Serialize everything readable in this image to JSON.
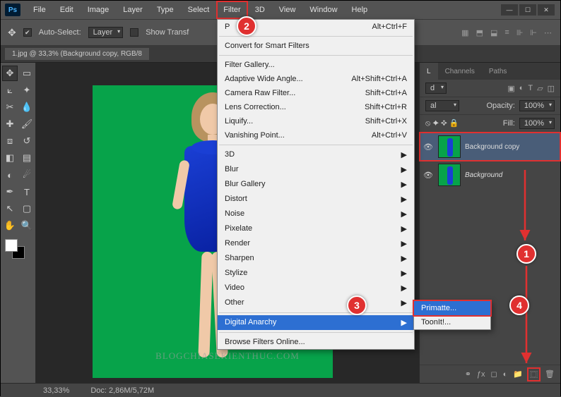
{
  "menubar": [
    "File",
    "Edit",
    "Image",
    "Layer",
    "Type",
    "Select",
    "Filter",
    "3D",
    "View",
    "Window",
    "Help"
  ],
  "active_menu_index": 6,
  "optbar": {
    "auto_select": "Auto-Select:",
    "layer_sel": "Layer",
    "show_transform": "Show Transf"
  },
  "doc_tab": "1.jpg @ 33,3% (Background copy, RGB/8",
  "filter_menu": {
    "top": {
      "label": "P",
      "shortcut": "Alt+Ctrl+F"
    },
    "convert": "Convert for Smart Filters",
    "gallery": "Filter Gallery...",
    "adaptive": {
      "label": "Adaptive Wide Angle...",
      "shortcut": "Alt+Shift+Ctrl+A"
    },
    "raw": {
      "label": "Camera Raw Filter...",
      "shortcut": "Shift+Ctrl+A"
    },
    "lens": {
      "label": "Lens Correction...",
      "shortcut": "Shift+Ctrl+R"
    },
    "liquify": {
      "label": "Liquify...",
      "shortcut": "Shift+Ctrl+X"
    },
    "vanish": {
      "label": "Vanishing Point...",
      "shortcut": "Alt+Ctrl+V"
    },
    "subs": [
      "3D",
      "Blur",
      "Blur Gallery",
      "Distort",
      "Noise",
      "Pixelate",
      "Render",
      "Sharpen",
      "Stylize",
      "Video",
      "Other"
    ],
    "digital": "Digital Anarchy",
    "browse": "Browse Filters Online..."
  },
  "submenu": {
    "primatte": "Primatte...",
    "toonit": "ToonIt!..."
  },
  "panels": {
    "tabs": [
      "L",
      "Channels",
      "Paths"
    ],
    "kind": "d",
    "blend": "al",
    "opacity_label": "Opacity:",
    "opacity_val": "100%",
    "fill_label": "Fill:",
    "fill_val": "100%",
    "layers": [
      {
        "name": "Background copy",
        "selected": true
      },
      {
        "name": "Background",
        "selected": false,
        "italic": true
      }
    ]
  },
  "status": {
    "zoom": "33,33%",
    "doc": "Doc:  2,86M/5,72M"
  },
  "watermark": "BLOGCHIASEKIENTHUC.COM",
  "callouts": {
    "c1": "1",
    "c2": "2",
    "c3": "3",
    "c4": "4"
  }
}
